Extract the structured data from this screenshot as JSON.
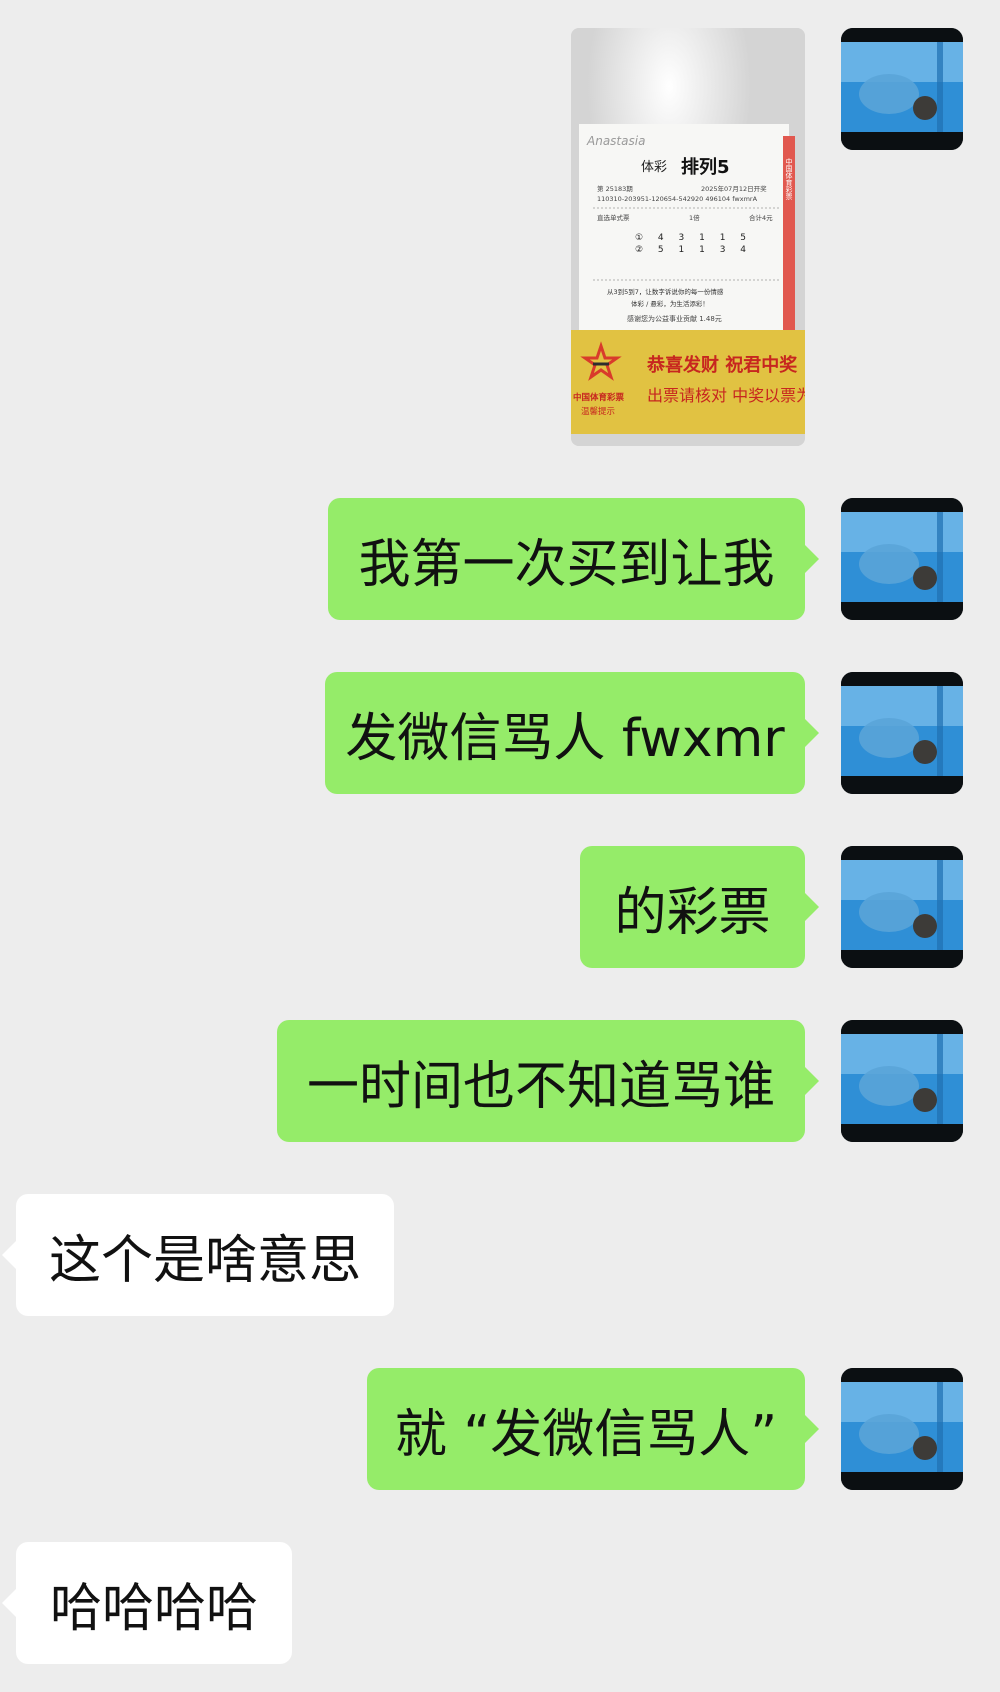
{
  "messages": [
    {
      "side": "out",
      "type": "image"
    },
    {
      "side": "out",
      "type": "text",
      "text": "我第一次买到让我"
    },
    {
      "side": "out",
      "type": "text",
      "text": "发微信骂人 fwxmr"
    },
    {
      "side": "out",
      "type": "text",
      "text": "的彩票"
    },
    {
      "side": "out",
      "type": "text",
      "text": "一时间也不知道骂谁"
    },
    {
      "side": "in",
      "type": "text",
      "text": "这个是啥意思"
    },
    {
      "side": "out",
      "type": "text",
      "text": "就 “发微信骂人”"
    },
    {
      "side": "in",
      "type": "text",
      "text": "哈哈哈哈"
    }
  ],
  "ticket": {
    "signature": "Anastasia",
    "brand": "体彩",
    "game": "排列5",
    "issue": "第 25183期",
    "date": "2025年07月12日开奖",
    "serial": "110310-203951-120654-542920 496104 fwxmrA",
    "play_type": "直选单式票",
    "multiple": "1倍",
    "total": "合计4元",
    "line1": "① 4 3 1 1 5",
    "line2": "② 5 1 1 3 4",
    "slogan1": "从3到5到7，让数字诉说你的每一份情感",
    "slogan2": "体彩 / 悬彩，为生活添彩！",
    "donation": "感谢您为公益事业贡献 1.48元",
    "banner1": "恭喜发财 祝君中奖",
    "banner2": "出票请核对 中奖以票为凭",
    "org": "中国体育彩票",
    "org_note": "温馨提示",
    "side_text": "中国体育彩票"
  },
  "colors": {
    "background": "#ededed",
    "outgoing_bubble": "#95ec69",
    "incoming_bubble": "#ffffff",
    "text": "#111111"
  }
}
